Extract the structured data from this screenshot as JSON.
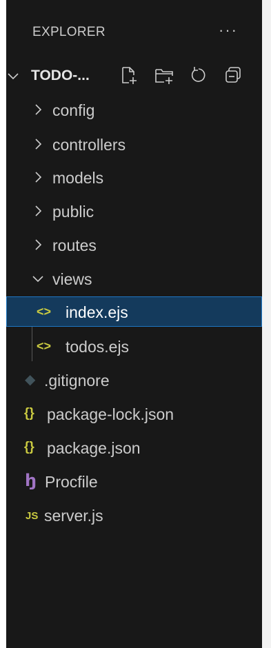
{
  "header": {
    "title": "EXPLORER",
    "more_label": "···"
  },
  "project": {
    "name": "TODO-...",
    "actions": [
      {
        "name": "new-file",
        "icon": "new-file-icon"
      },
      {
        "name": "new-folder",
        "icon": "new-folder-icon"
      },
      {
        "name": "refresh",
        "icon": "refresh-icon"
      },
      {
        "name": "collapse-all",
        "icon": "collapse-all-icon"
      }
    ]
  },
  "tree": {
    "folders": [
      {
        "label": "config",
        "expanded": false
      },
      {
        "label": "controllers",
        "expanded": false
      },
      {
        "label": "models",
        "expanded": false
      },
      {
        "label": "public",
        "expanded": false
      },
      {
        "label": "routes",
        "expanded": false
      },
      {
        "label": "views",
        "expanded": true
      }
    ],
    "views_children": [
      {
        "label": "index.ejs",
        "icon": "<>",
        "icon_name": "ejs-file-icon",
        "selected": true
      },
      {
        "label": "todos.ejs",
        "icon": "<>",
        "icon_name": "ejs-file-icon",
        "selected": false
      }
    ],
    "root_files": [
      {
        "label": ".gitignore",
        "icon": "◆",
        "icon_name": "git-icon"
      },
      {
        "label": "package-lock.json",
        "icon": "{}",
        "icon_name": "json-icon"
      },
      {
        "label": "package.json",
        "icon": "{}",
        "icon_name": "json-icon"
      },
      {
        "label": "Procfile",
        "icon": "ꜧ",
        "icon_name": "heroku-icon"
      },
      {
        "label": "server.js",
        "icon": "JS",
        "icon_name": "javascript-icon"
      }
    ]
  },
  "colors": {
    "panel_bg": "#181818",
    "text": "#cccccc",
    "selection_bg": "#143a5c",
    "selection_border": "#1f77c4",
    "ejs_icon": "#cbcb41",
    "json_icon": "#cbcb41",
    "js_icon": "#cbcb41",
    "git_icon": "#41535b",
    "heroku_icon": "#a074c4"
  }
}
